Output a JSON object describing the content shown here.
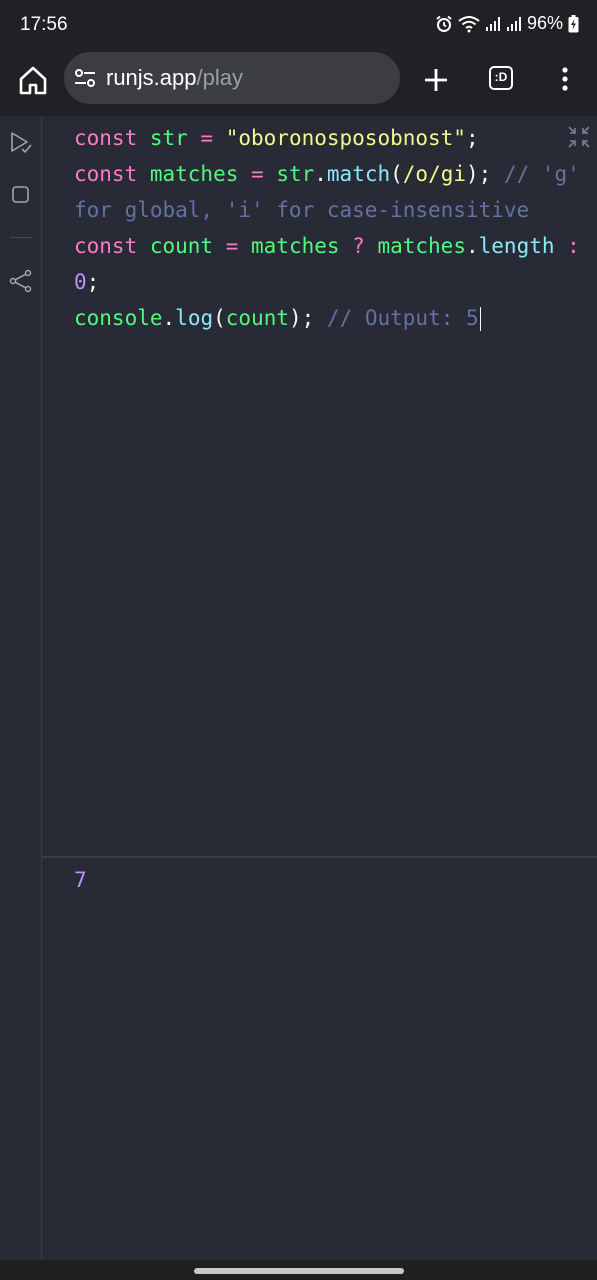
{
  "status_bar": {
    "time": "17:56",
    "battery": "96%",
    "icons": [
      "alarm-icon",
      "wifi-icon",
      "signal-icon",
      "signal-icon",
      "battery-charging-icon"
    ]
  },
  "browser": {
    "url_domain": "runjs.app",
    "url_path": "/play",
    "tabs_label": ":D"
  },
  "sidebar": {
    "items": [
      "run-check-icon",
      "stop-square-icon",
      "share-icon"
    ]
  },
  "editor": {
    "lines": [
      {
        "tokens": [
          {
            "t": "const ",
            "c": "kw"
          },
          {
            "t": "str ",
            "c": "var"
          },
          {
            "t": "= ",
            "c": "op"
          },
          {
            "t": "\"oboronosposobnost\"",
            "c": "str"
          },
          {
            "t": ";",
            "c": "punc"
          }
        ]
      },
      {
        "tokens": [
          {
            "t": "const ",
            "c": "kw"
          },
          {
            "t": "matches ",
            "c": "var"
          },
          {
            "t": "= ",
            "c": "op"
          },
          {
            "t": "str",
            "c": "var"
          },
          {
            "t": ".",
            "c": "punc"
          },
          {
            "t": "match",
            "c": "fn"
          },
          {
            "t": "(",
            "c": "punc"
          },
          {
            "t": "/o/gi",
            "c": "str"
          },
          {
            "t": "); ",
            "c": "punc"
          },
          {
            "t": "// 'g'",
            "c": "cmt"
          }
        ]
      },
      {
        "tokens": [
          {
            "t": "for global, 'i' for case-insensitive",
            "c": "cmt"
          }
        ]
      },
      {
        "tokens": [
          {
            "t": "const ",
            "c": "kw"
          },
          {
            "t": "count ",
            "c": "var"
          },
          {
            "t": "= ",
            "c": "op"
          },
          {
            "t": "matches ",
            "c": "var"
          },
          {
            "t": "? ",
            "c": "op"
          },
          {
            "t": "matches",
            "c": "var"
          },
          {
            "t": ".",
            "c": "punc"
          },
          {
            "t": "length ",
            "c": "fn"
          },
          {
            "t": ":",
            "c": "op"
          }
        ]
      },
      {
        "tokens": [
          {
            "t": "0",
            "c": "num"
          },
          {
            "t": ";",
            "c": "punc"
          }
        ]
      },
      {
        "tokens": [
          {
            "t": "console",
            "c": "var"
          },
          {
            "t": ".",
            "c": "punc"
          },
          {
            "t": "log",
            "c": "fn"
          },
          {
            "t": "(",
            "c": "punc"
          },
          {
            "t": "count",
            "c": "var"
          },
          {
            "t": "); ",
            "c": "punc"
          },
          {
            "t": "// Output: 5",
            "c": "cmt"
          }
        ]
      }
    ]
  },
  "output": {
    "value": "7"
  },
  "colors": {
    "background": "#282a36",
    "keyword": "#ff79c6",
    "variable": "#50fa7b",
    "string": "#f1fa8c",
    "function": "#8be9fd",
    "comment": "#6272a4",
    "number": "#bd93f9"
  }
}
